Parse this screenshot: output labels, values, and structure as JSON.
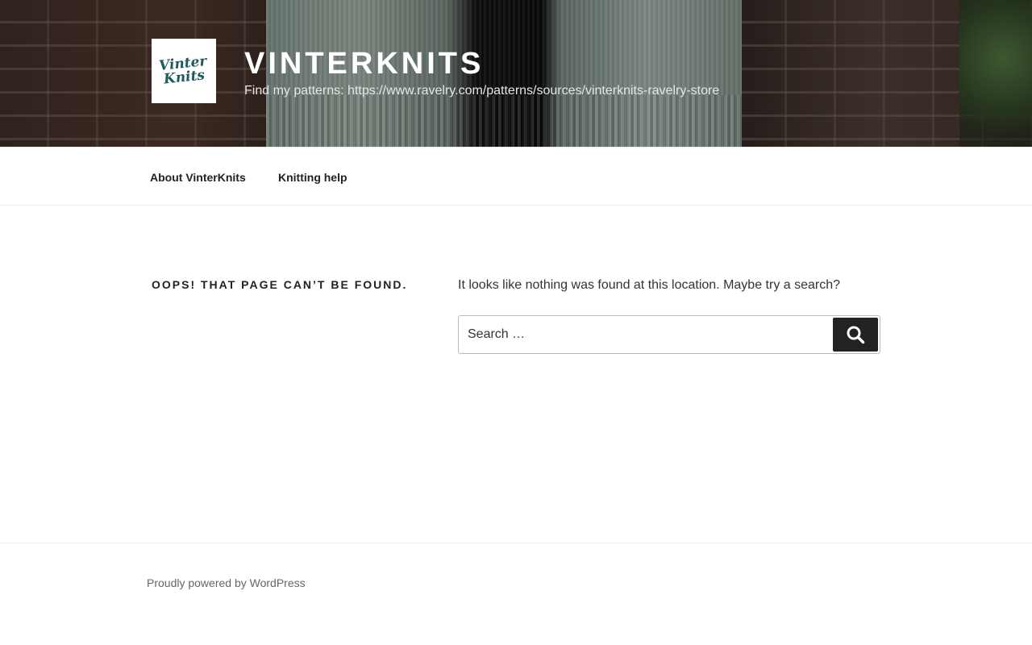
{
  "header": {
    "logo_line1": "Vinter",
    "logo_line2": "Knits",
    "title": "VINTERKNITS",
    "description": "Find my patterns: https://www.ravelry.com/patterns/sources/vinterknits-ravelry-store"
  },
  "nav": {
    "items": [
      {
        "label": "About VinterKnits"
      },
      {
        "label": "Knitting help"
      }
    ]
  },
  "main": {
    "page_title": "OOPS! THAT PAGE CAN’T BE FOUND.",
    "message": "It looks like nothing was found at this location. Maybe try a search?",
    "search": {
      "placeholder": "Search …",
      "value": "",
      "button_icon": "search-icon"
    }
  },
  "footer": {
    "credit": "Proudly powered by WordPress"
  },
  "colors": {
    "accent": "#222222",
    "logo": "#1d5b5e"
  }
}
